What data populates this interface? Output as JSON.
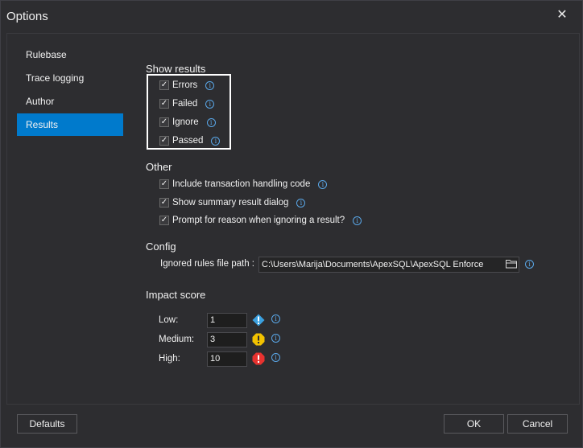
{
  "window": {
    "title": "Options",
    "close_glyph": "✕"
  },
  "sidebar": {
    "items": [
      {
        "label": "Rulebase"
      },
      {
        "label": "Trace logging"
      },
      {
        "label": "Author"
      },
      {
        "label": "Results"
      }
    ],
    "active": "Results"
  },
  "show_results": {
    "title": "Show results",
    "items": [
      {
        "label": "Errors",
        "checked": true
      },
      {
        "label": "Failed",
        "checked": true
      },
      {
        "label": "Ignore",
        "checked": true
      },
      {
        "label": "Passed",
        "checked": true
      }
    ]
  },
  "other": {
    "title": "Other",
    "items": [
      {
        "label": "Include transaction handling code",
        "checked": true
      },
      {
        "label": "Show summary result dialog",
        "checked": true
      },
      {
        "label": "Prompt for reason when ignoring a result?",
        "checked": true
      }
    ]
  },
  "config": {
    "title": "Config",
    "path_label": "Ignored rules file path :",
    "path_value": "C:\\Users\\Marija\\Documents\\ApexSQL\\ApexSQL Enforce"
  },
  "impact": {
    "title": "Impact score",
    "rows": [
      {
        "label": "Low:",
        "value": "1",
        "icon": "info-alert-icon",
        "color": "#3ba1e0"
      },
      {
        "label": "Medium:",
        "value": "3",
        "icon": "warning-alert-icon",
        "color": "#f2c200"
      },
      {
        "label": "High:",
        "value": "10",
        "icon": "error-alert-icon",
        "color": "#e8322f"
      }
    ]
  },
  "check_glyph": "✓",
  "info_glyph": "i",
  "buttons": {
    "defaults": "Defaults",
    "ok": "OK",
    "cancel": "Cancel"
  },
  "colors": {
    "accent": "#007acc",
    "info": "#5aa7e8"
  }
}
